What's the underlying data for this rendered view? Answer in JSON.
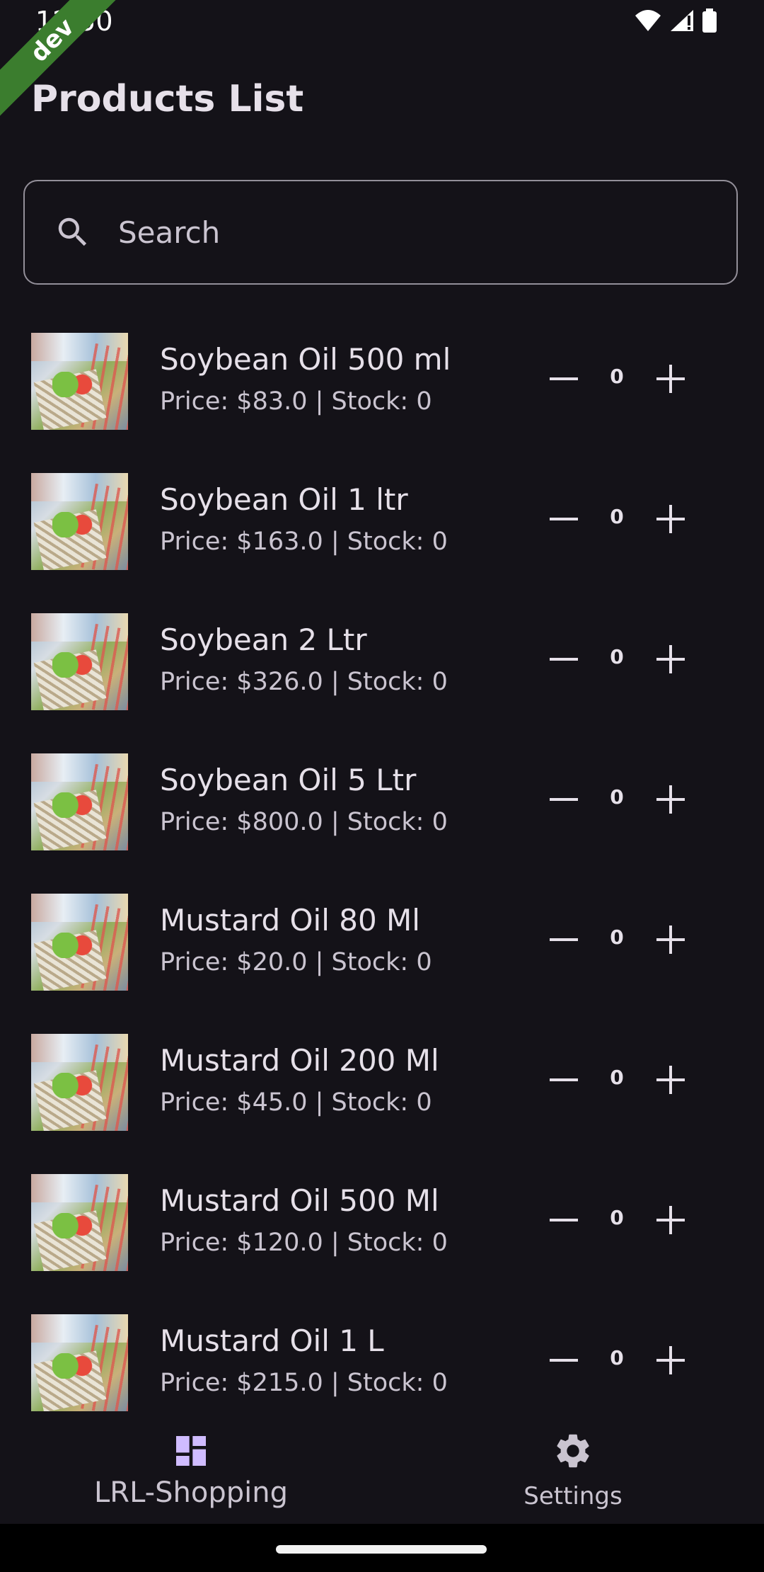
{
  "status_bar": {
    "time": "12:50"
  },
  "ribbon": {
    "label": "dev"
  },
  "header": {
    "title": "Products List"
  },
  "search": {
    "placeholder": "Search",
    "value": ""
  },
  "products": [
    {
      "name": "Soybean Oil 500 ml",
      "meta": "Price: $83.0 | Stock: 0",
      "qty": "0"
    },
    {
      "name": "Soybean Oil 1 ltr",
      "meta": "Price: $163.0 | Stock: 0",
      "qty": "0"
    },
    {
      "name": "Soybean 2 Ltr",
      "meta": "Price: $326.0 | Stock: 0",
      "qty": "0"
    },
    {
      "name": "Soybean Oil 5 Ltr",
      "meta": "Price: $800.0 | Stock: 0",
      "qty": "0"
    },
    {
      "name": "Mustard Oil 80 Ml",
      "meta": "Price: $20.0 | Stock: 0",
      "qty": "0"
    },
    {
      "name": "Mustard Oil 200 Ml",
      "meta": "Price: $45.0 | Stock: 0",
      "qty": "0"
    },
    {
      "name": "Mustard Oil 500 Ml",
      "meta": "Price: $120.0 | Stock: 0",
      "qty": "0"
    },
    {
      "name": "Mustard Oil 1 L",
      "meta": "Price: $215.0 | Stock: 0",
      "qty": "0"
    }
  ],
  "bottom_nav": {
    "items": [
      {
        "label": "LRL-Shopping",
        "icon": "dashboard-icon"
      },
      {
        "label": "Settings",
        "icon": "gear-icon"
      }
    ]
  },
  "colors": {
    "background": "#141218",
    "text_primary": "#e6e0e9",
    "text_secondary": "#cac4d0",
    "outline": "#938f99",
    "ribbon": "#3b7d2e",
    "nav_icon_active": "#d0bcff"
  }
}
